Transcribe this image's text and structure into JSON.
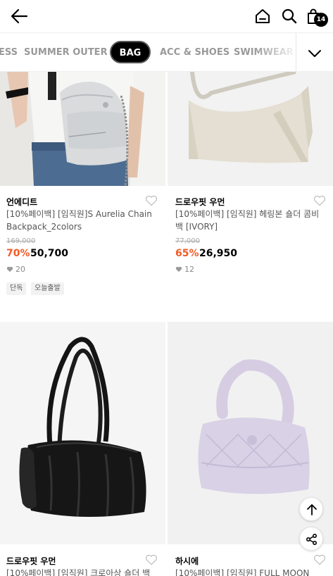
{
  "header": {
    "cart_count": "14",
    "icons": [
      "back-arrow-icon",
      "home-icon",
      "search-icon",
      "shopping-bag-icon"
    ]
  },
  "category_tabs": {
    "items": [
      {
        "label": "ESS"
      },
      {
        "label": "SUMMER OUTER"
      },
      {
        "label": "BAG",
        "active": true
      },
      {
        "label": "ACC & SHOES"
      },
      {
        "label": "SWIMWEAR"
      }
    ]
  },
  "products": [
    {
      "brand": "언에디트",
      "name": "[10%페이백] [임직원]S Aurelia Chain Backpack_2colors",
      "original_price": "169,000",
      "discount": "70%",
      "price": "50,700",
      "likes": "20",
      "tags": [
        "단독",
        "오늘출발"
      ],
      "image": "silver-chain-backpack"
    },
    {
      "brand": "드로우핏 우먼",
      "name": "[10%페이백] [임직원] 헤링본 숄더 콤비백 [IVORY]",
      "original_price": "77,000",
      "discount": "65%",
      "price": "26,950",
      "likes": "12",
      "tags": [],
      "image": "ivory-shoulder-bag"
    },
    {
      "brand": "드로우핏 우먼",
      "name": "[10%페이백] [임직원] 크로아상 숄더 백",
      "image": "black-shoulder-bag"
    },
    {
      "brand": "하시에",
      "name": "[10%페이백] [임직원] FULL MOON",
      "image": "lavender-padded-bag"
    }
  ],
  "colors": {
    "discount": "#f15a24",
    "accent": "#000000"
  },
  "floating": {
    "icons": [
      "arrow-up-icon",
      "share-icon"
    ]
  }
}
